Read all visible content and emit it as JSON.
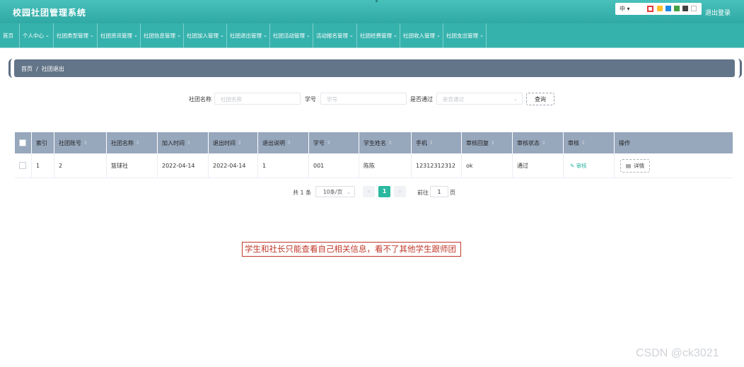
{
  "header": {
    "title": "校园社团管理系统",
    "lang": "中",
    "swatches": [
      "#e53935",
      "#fbc02d",
      "#1e88e5",
      "#43a047",
      "#424242",
      "#ffffff"
    ],
    "logout": "退出登录"
  },
  "nav": [
    {
      "label": "首页",
      "dropdown": false
    },
    {
      "label": "个人中心",
      "dropdown": true
    },
    {
      "label": "社团类型管理",
      "dropdown": true
    },
    {
      "label": "社团资讯管理",
      "dropdown": true
    },
    {
      "label": "社团信息管理",
      "dropdown": true
    },
    {
      "label": "社团加入管理",
      "dropdown": true
    },
    {
      "label": "社团退出管理",
      "dropdown": true
    },
    {
      "label": "社团活动管理",
      "dropdown": true
    },
    {
      "label": "活动报名管理",
      "dropdown": true
    },
    {
      "label": "社团经费管理",
      "dropdown": true
    },
    {
      "label": "社团收入管理",
      "dropdown": true
    },
    {
      "label": "社团支出管理",
      "dropdown": true
    }
  ],
  "breadcrumb": {
    "home": "首页",
    "sep": "/",
    "current": "社团退出"
  },
  "search": {
    "club_name_label": "社团名称",
    "club_name_placeholder": "社团名称",
    "student_id_label": "学号",
    "student_id_placeholder": "学号",
    "approved_label": "是否通过",
    "approved_placeholder": "是否通过",
    "query_button": "查询"
  },
  "table": {
    "columns": [
      "索引",
      "社团账号",
      "社团名称",
      "加入时间",
      "退出时间",
      "退出说明",
      "学号",
      "学生姓名",
      "手机",
      "审核回复",
      "审核状态",
      "审核",
      "操作"
    ],
    "rows": [
      {
        "index": "1",
        "club_account": "2",
        "club_name": "篮球社",
        "join_time": "2022-04-14",
        "exit_time": "2022-04-14",
        "exit_note": "1",
        "student_id": "001",
        "student_name": "陈陈",
        "phone": "12312312312",
        "reply": "ok",
        "status": "通过",
        "audit_link": "审核",
        "detail_button": "详情"
      }
    ]
  },
  "pagination": {
    "total": "共 1 条",
    "page_size": "10条/页",
    "current_page": "1",
    "goto_label": "前往",
    "goto_value": "1",
    "page_unit": "页"
  },
  "annotation": "学生和社长只能查看自己相关信息，看不了其他学生跟师团",
  "watermark": "CSDN @ck3021"
}
